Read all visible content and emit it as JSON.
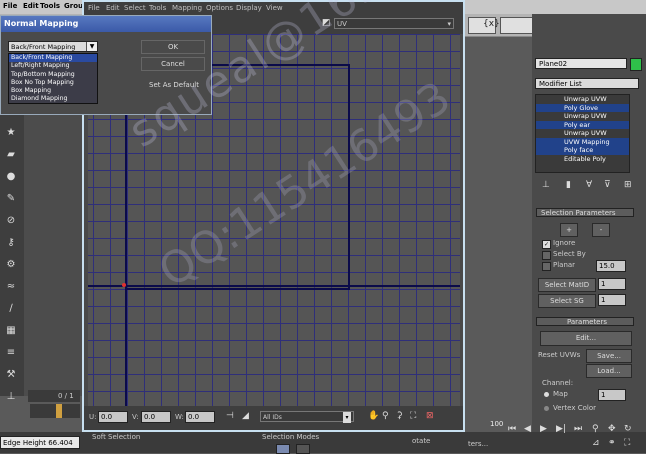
{
  "main_menu": {
    "items": [
      "File",
      "Edit",
      "Tools",
      "Group"
    ]
  },
  "uvw_editor": {
    "menu": [
      "File",
      "Edit",
      "Select",
      "Tools",
      "Mapping",
      "Options",
      "Display",
      "View"
    ],
    "toolbar_combo": "UV",
    "u_label": "U:",
    "u_value": "0.0",
    "v_label": "V:",
    "v_value": "0.0",
    "w_label": "W:",
    "w_value": "0.0",
    "ids_combo": "All IDs",
    "zoom_value": "100"
  },
  "dialog": {
    "title": "Normal Mapping",
    "selected": "Back/Front Mapping",
    "options": [
      "Back/Front Mapping",
      "Left/Right Mapping",
      "Top/Bottom Mapping",
      "Box No Top Mapping",
      "Box Mapping",
      "Diamond Mapping"
    ],
    "ok_label": "OK",
    "cancel_label": "Cancel",
    "default_label": "Set As Default"
  },
  "command_panel": {
    "object_name": "Plane02",
    "modifier_list_label": "Modifier List",
    "stack": [
      "Unwrap UVW",
      "Poly Glove",
      "Unwrap UVW",
      "Poly ear",
      "Unwrap UVW",
      "UVW Mapping",
      "Poly face",
      "Editable Poly"
    ],
    "selection_params_title": "Selection Parameters",
    "plus_label": "+",
    "minus_label": "-",
    "ignore_label": "Ignore",
    "select_by_label": "Select By",
    "planar_label": "Planar",
    "planar_value": "15.0",
    "select_matid_label": "Select MatID",
    "select_matid_value": "1",
    "select_sg_label": "Select SG",
    "select_sg_value": "1",
    "parameters_title": "Parameters",
    "edit_label": "Edit...",
    "reset_uvws_label": "Reset UVWs",
    "save_label": "Save...",
    "load_label": "Load...",
    "channel_label": "Channel:",
    "map_label": "Map",
    "map_value": "1",
    "vertex_color_label": "Vertex Color"
  },
  "bottom": {
    "edge_height": "Edge Height 66.404",
    "soft_selection": "Soft Selection",
    "selection_modes": "Selection Modes",
    "rotate_label": "otate",
    "frame_value": "0 / 1",
    "filters_label": "ters..."
  },
  "watermark": {
    "line1": "squeal@163.com",
    "line2": "QQ:115416493"
  }
}
